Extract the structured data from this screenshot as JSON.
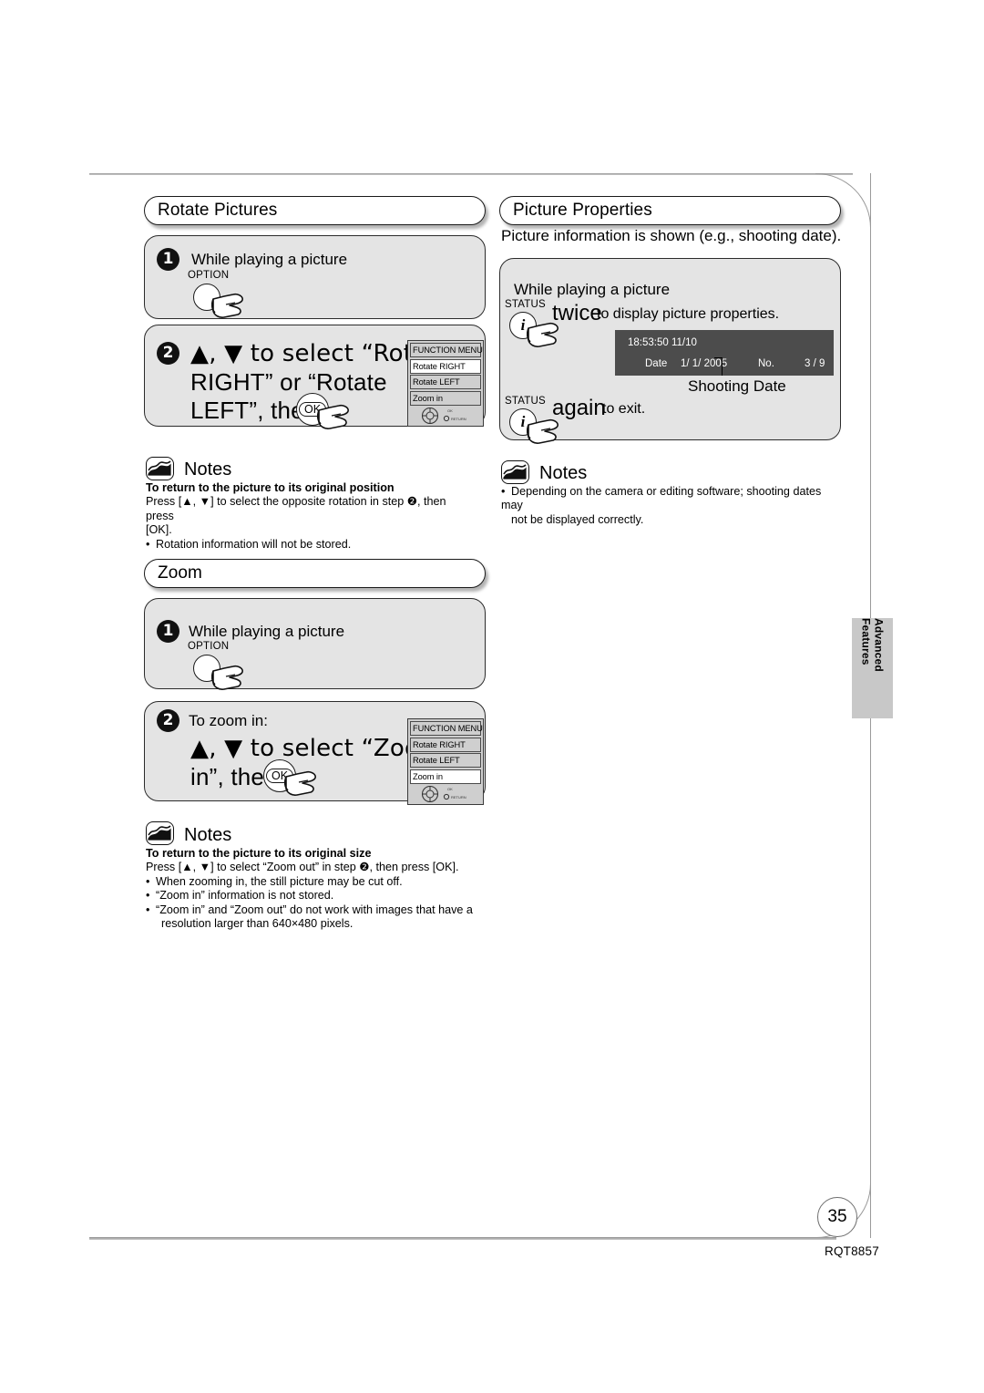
{
  "page": {
    "number": "35",
    "doc_code": "RQT8857",
    "side_tab": "Advanced Features"
  },
  "sections": {
    "rotate": {
      "title": "Rotate Pictures",
      "step1": {
        "num": "1",
        "text": "While playing a picture",
        "key_label": "OPTION"
      },
      "step2": {
        "num": "2",
        "line1": "▲, ▼ to select “Rotate",
        "line2": "RIGHT” or “Rotate",
        "line3": "LEFT”, then",
        "ok_label": "OK"
      },
      "menu": {
        "title": "FUNCTION MENU",
        "items": [
          "Rotate RIGHT",
          "Rotate LEFT",
          "Zoom in"
        ],
        "selected": "Rotate RIGHT",
        "foot_ok": "OK",
        "foot_return": "RETURN"
      },
      "notes": {
        "heading": "Notes",
        "bold_line": "To return to the picture to its original position",
        "body_line1": "Press [▲, ▼] to select the opposite rotation in step ❷, then press",
        "body_line2": "[OK].",
        "bullets": [
          "Rotation information will not be stored."
        ]
      }
    },
    "properties": {
      "title": "Picture Properties",
      "intro": "Picture information is shown (e.g., shooting date).",
      "lead": "While playing a picture",
      "key_label_1": "STATUS",
      "action1_strong": "twice",
      "action1_rest": "to display picture properties.",
      "key_label_2": "STATUS",
      "action2_strong": "again",
      "action2_rest": "to exit.",
      "osd": {
        "time": "18:53:50 11/10",
        "date_label": "Date",
        "date_value": "1/ 1/ 2005",
        "no_label": "No.",
        "no_value": "3 / 9"
      },
      "callout": "Shooting Date",
      "notes": {
        "heading": "Notes",
        "bullets": [
          "Depending on the camera or editing software; shooting dates may",
          "not be displayed correctly."
        ]
      }
    },
    "zoom": {
      "title": "Zoom",
      "step1": {
        "num": "1",
        "text": "While playing a picture",
        "key_label": "OPTION"
      },
      "step2": {
        "num": "2",
        "lead": "To zoom in:",
        "line1": "▲, ▼ to select “Zoom",
        "line2": "in”, then",
        "ok_label": "OK"
      },
      "menu": {
        "title": "FUNCTION MENU",
        "items": [
          "Rotate RIGHT",
          "Rotate LEFT",
          "Zoom in"
        ],
        "selected": "Zoom in",
        "foot_ok": "OK",
        "foot_return": "RETURN"
      },
      "notes": {
        "heading": "Notes",
        "bold_line": "To return to the picture to its original size",
        "body_line1": "Press [▲, ▼] to select “Zoom out” in step ❷, then press [OK].",
        "bullets": [
          "When zooming in, the still picture may be cut off.",
          "“Zoom in” information is not stored.",
          "“Zoom in” and “Zoom out” do not work with images that have a",
          "resolution larger than 640×480 pixels."
        ]
      }
    }
  },
  "colors": {
    "panel_bg": "#e4e4e4",
    "menu_bg": "#cfcfcf",
    "osd_bg": "#4c4c4c",
    "tab_bg": "#c8c8c8"
  }
}
